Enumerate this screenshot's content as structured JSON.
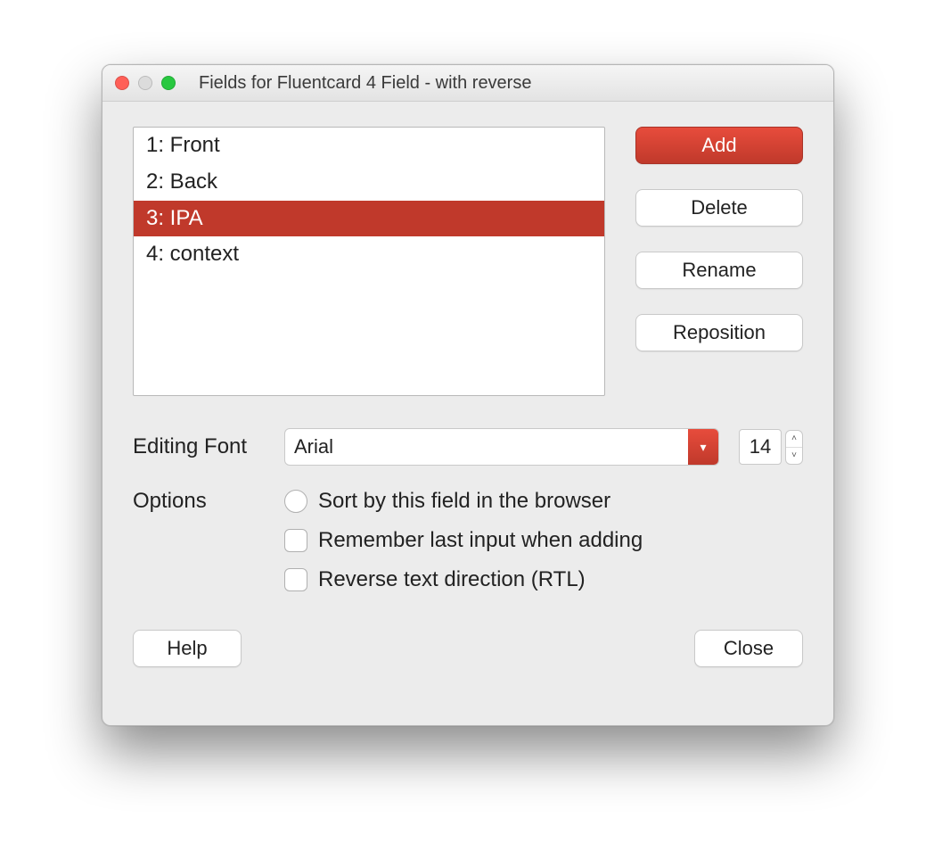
{
  "window": {
    "title": "Fields for Fluentcard 4 Field - with reverse"
  },
  "fields_list": {
    "items": [
      {
        "label": "1: Front",
        "selected": false
      },
      {
        "label": "2: Back",
        "selected": false
      },
      {
        "label": "3: IPA",
        "selected": true
      },
      {
        "label": "4: context",
        "selected": false
      }
    ]
  },
  "side_buttons": {
    "add": "Add",
    "delete": "Delete",
    "rename": "Rename",
    "reposition": "Reposition"
  },
  "editing_font": {
    "label": "Editing Font",
    "value": "Arial",
    "size": "14"
  },
  "options": {
    "label": "Options",
    "sort_label": "Sort by this field in the browser",
    "remember_label": "Remember last input when adding",
    "rtl_label": "Reverse text direction (RTL)"
  },
  "bottom": {
    "help": "Help",
    "close": "Close"
  }
}
